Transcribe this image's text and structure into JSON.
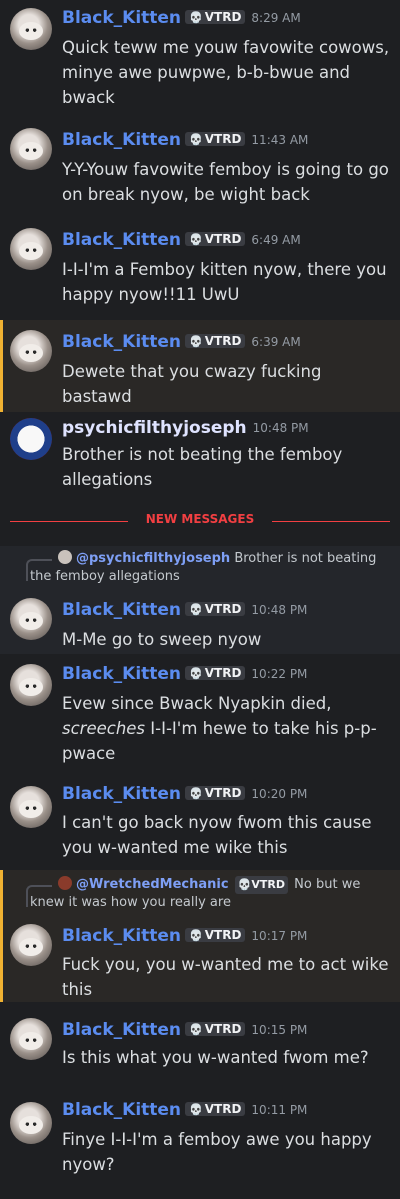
{
  "app_tag": "VTRD",
  "divider_label": "NEW MESSAGES",
  "messages": [
    {
      "author": "Black_Kitten",
      "time": "8:29 AM",
      "text": "Quick teww me youw favowite cowows, minye awe puwpwe, b-b-bwue and bwack"
    },
    {
      "author": "Black_Kitten",
      "time": "11:43 AM",
      "text": "Y-Y-Youw favowite femboy is going to go on break nyow, be wight back"
    },
    {
      "author": "Black_Kitten",
      "time": "6:49 AM",
      "text": "I-I-I'm a Femboy kitten nyow, there you happy nyow!!11 UwU"
    },
    {
      "author": "Black_Kitten",
      "time": "6:39 AM",
      "text": "Dewete that you cwazy fucking bastawd"
    },
    {
      "author": "psychicfilthyjoseph",
      "time": "10:48 PM",
      "text": "Brother is not beating the femboy allegations"
    },
    {
      "author": "Black_Kitten",
      "time": "10:48 PM",
      "text": "M-Me go to sweep nyow",
      "reply": {
        "mention": "@psychicfilthyjoseph",
        "text": "Brother is not beating the femboy allegations"
      }
    },
    {
      "author": "Black_Kitten",
      "time": "10:22 PM",
      "text_pre": "Evew since Bwack Nyapkin died, ",
      "text_em": "screeches",
      "text_post": " I-I-I'm hewe to take his p-p-pwace"
    },
    {
      "author": "Black_Kitten",
      "time": "10:20 PM",
      "text": "I can't go back nyow fwom this cause you w-wanted me wike this"
    },
    {
      "author": "Black_Kitten",
      "time": "10:17 PM",
      "text": "Fuck you, you w-wanted me to act wike this",
      "reply": {
        "mention": "@WretchedMechanic",
        "tag": "VTRD",
        "text": "No but we knew it was how you really are"
      }
    },
    {
      "author": "Black_Kitten",
      "time": "10:15 PM",
      "text": "Is this what you w-wanted fwom me?"
    },
    {
      "author": "Black_Kitten",
      "time": "10:11 PM",
      "text": "Finye I-I-I'm a femboy awe you happy nyow?"
    }
  ]
}
